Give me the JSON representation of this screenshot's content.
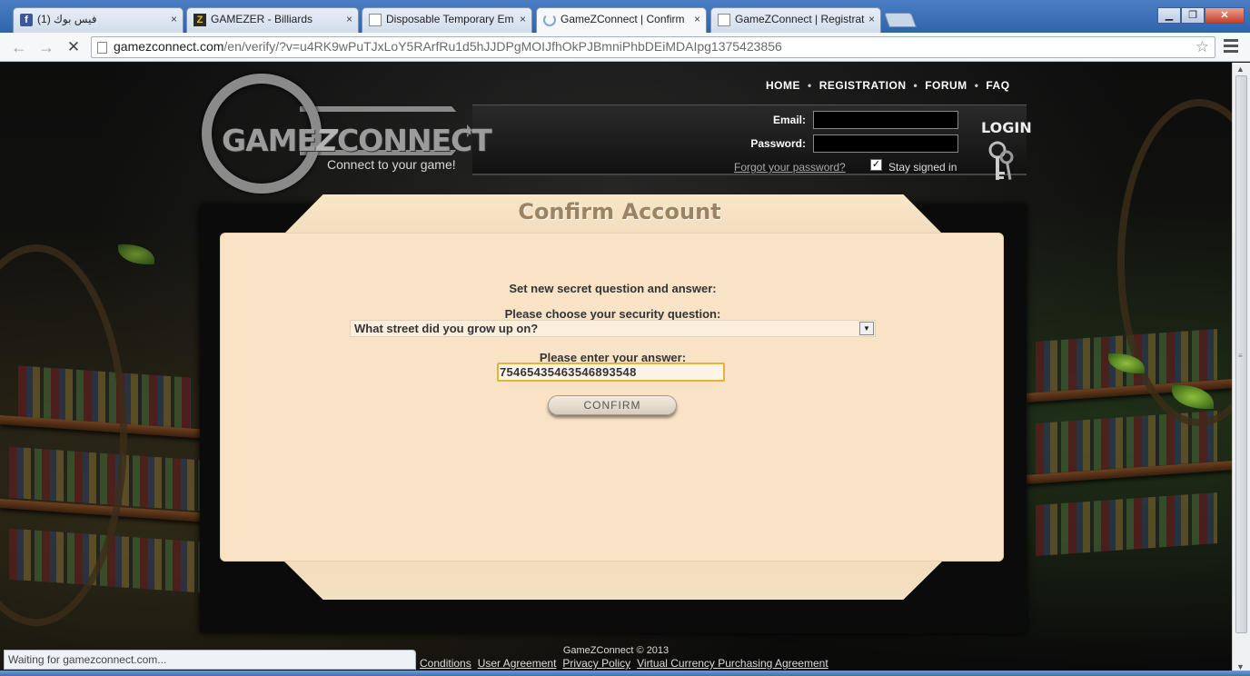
{
  "browser": {
    "tabs": [
      {
        "label": "فيس بوك (1)",
        "icon": "facebook-icon"
      },
      {
        "label": "GAMEZER - Billiards",
        "icon": "gamezer-icon"
      },
      {
        "label": "Disposable Temporary Em",
        "icon": "page-icon"
      },
      {
        "label": "GameZConnect | Confirm",
        "icon": "loading-icon",
        "active": true
      },
      {
        "label": "GameZConnect | Registrat",
        "icon": "page-icon"
      }
    ],
    "close_glyph": "×",
    "url_host": "gamezconnect.com",
    "url_path": "/en/verify/?v=u4RK9wPuTJxLoY5RArfRu1d5hJJDPgMOIJfhOkPJBmniPhbDEiMDAIpg1375423856",
    "status_text": "Waiting for gamezconnect.com..."
  },
  "site": {
    "logo_text": "GAME",
    "logo_text_2": "CONNECT",
    "logo_z": "Z",
    "tagline": "Connect to your game!",
    "nav": [
      "HOME",
      "REGISTRATION",
      "FORUM",
      "FAQ"
    ],
    "nav_sep": "•",
    "login": {
      "email_label": "Email:",
      "password_label": "Password:",
      "forgot": "Forgot your password?",
      "stay_signed": "Stay signed in",
      "title": "LOGIN"
    }
  },
  "confirm": {
    "title": "Confirm Account",
    "set_new": "Set new secret question and answer:",
    "choose_label": "Please choose your security question:",
    "selected_question": "What street did you grow up on?",
    "answer_label": "Please enter your answer:",
    "answer_value": "75465435463546893548",
    "button": "CONFIRM"
  },
  "footer": {
    "copyright": "GameZConnect © 2013",
    "links": [
      "Conditions",
      "User Agreement",
      "Privacy Policy",
      "Virtual Currency Purchasing Agreement"
    ]
  }
}
